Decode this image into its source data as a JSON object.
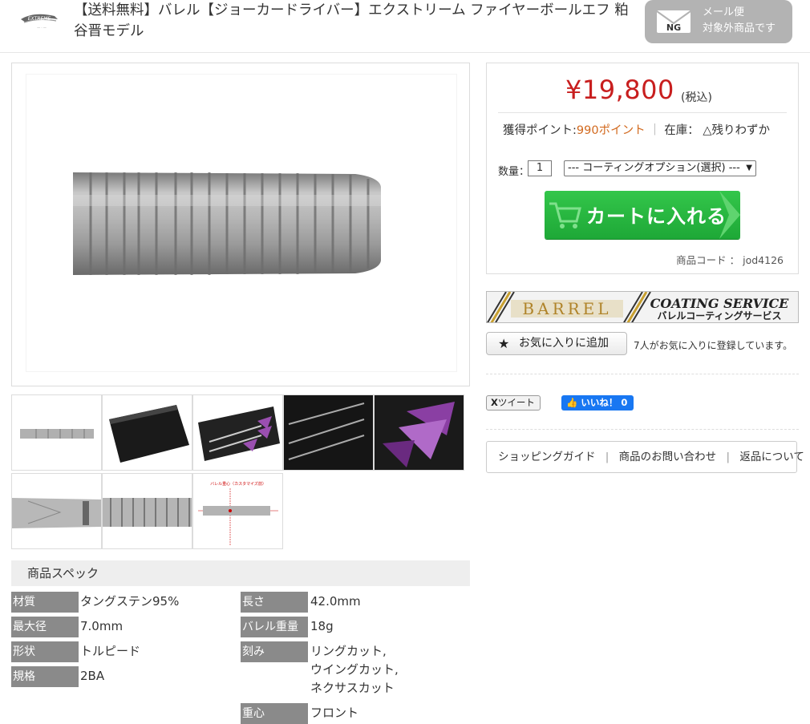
{
  "header": {
    "logo_text": "EXTREME",
    "title": "【送料無料】バレル【ジョーカードライバー】エクストリーム ファイヤーボールエフ 粕谷晋モデル",
    "mail_badge": {
      "ng": "NG",
      "line1": "メール便",
      "line2": "対象外商品です"
    }
  },
  "thumbs": [
    {
      "name": "barrel-side"
    },
    {
      "name": "black-box"
    },
    {
      "name": "darts-set-purple"
    },
    {
      "name": "darts-in-case"
    },
    {
      "name": "purple-flights"
    },
    {
      "name": "barrel-closeup-logo"
    },
    {
      "name": "barrel-rings-closeup"
    },
    {
      "name": "balance-diagram",
      "caption": "バレル重心（カスタマイズ前）"
    }
  ],
  "spec": {
    "heading": "商品スペック",
    "rows_left": [
      {
        "label": "材質",
        "value": "タングステン95%"
      },
      {
        "label": "最大径",
        "value": "7.0mm"
      },
      {
        "label": "形状",
        "value": "トルピード"
      },
      {
        "label": "規格",
        "value": "2BA"
      }
    ],
    "rows_right": [
      {
        "label": "長さ",
        "value": "42.0mm"
      },
      {
        "label": "バレル重量",
        "value": "18g"
      },
      {
        "label": "刻み",
        "values": [
          "リングカット,",
          "ウイングカット,",
          "ネクサスカット"
        ]
      },
      {
        "label": "重心",
        "value": "フロント"
      }
    ]
  },
  "purchase": {
    "price": "¥19,800",
    "tax": "(税込)",
    "points_label": "獲得ポイント:",
    "points_value": "990ポイント",
    "stock_sep": "｜",
    "stock_label": "在庫：",
    "stock_value": "△残りわずか",
    "qty_label": "数量：",
    "qty_value": "1",
    "coating_option": "--- コーティングオプション(選択) ---",
    "cart_label": "カートに入れる",
    "product_code": "商品コード ： jod4126"
  },
  "banner": {
    "brand": "BARREL",
    "line1": "COATING SERVICE",
    "line2": "バレルコーティングサービス"
  },
  "favorite": {
    "button": "お気に入りに追加",
    "count_text": "7人がお気に入りに登録しています。"
  },
  "social": {
    "tweet": "ツイート",
    "x_mark": "X",
    "like": "いいね！ 0"
  },
  "links": [
    "ショッピングガイド",
    "商品のお問い合わせ",
    "返品について"
  ],
  "colors": {
    "price": "#c81e1e",
    "points": "#d2691e",
    "cart": "#1ea837",
    "facebook": "#1877f2"
  }
}
